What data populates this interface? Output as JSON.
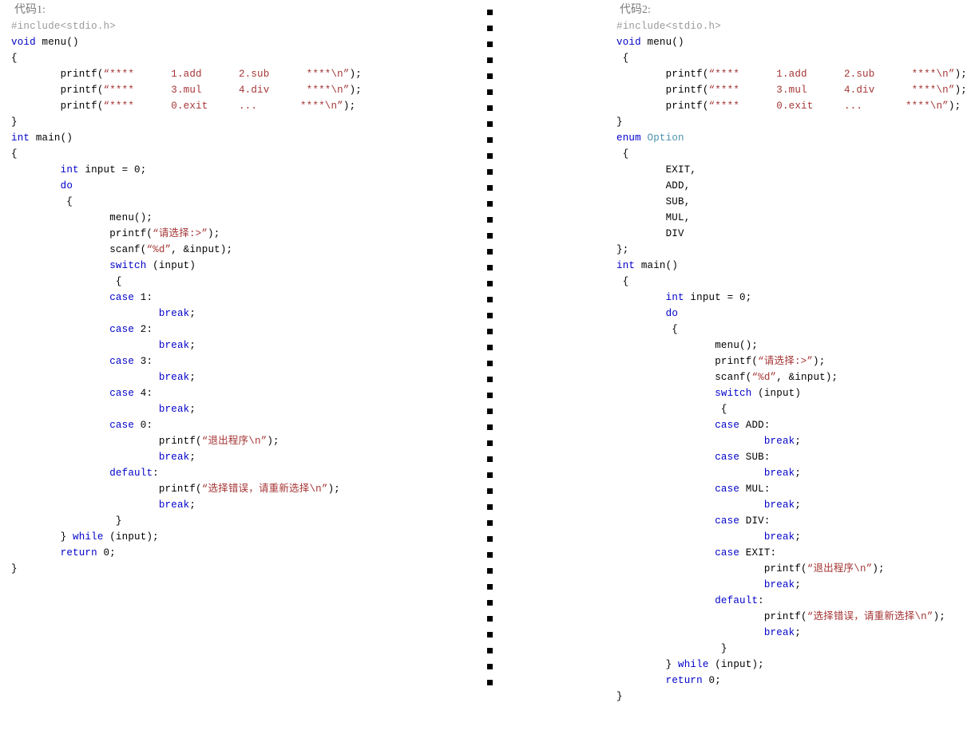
{
  "left": {
    "caption": "代码1:",
    "lines": [
      [
        {
          "t": "#include<stdio.h>",
          "c": "pre"
        }
      ],
      [
        {
          "t": "void ",
          "c": "kw"
        },
        {
          "t": "menu()",
          "c": "pun"
        }
      ],
      [
        {
          "t": "{",
          "c": "pun"
        }
      ],
      [
        {
          "t": "        printf(",
          "c": "pun"
        },
        {
          "t": "“****      1.add      2.sub      ****\\n”",
          "c": "str"
        },
        {
          "t": ");",
          "c": "pun"
        }
      ],
      [
        {
          "t": "        printf(",
          "c": "pun"
        },
        {
          "t": "“****      3.mul      4.div      ****\\n”",
          "c": "str"
        },
        {
          "t": ");",
          "c": "pun"
        }
      ],
      [
        {
          "t": "        printf(",
          "c": "pun"
        },
        {
          "t": "“****      0.exit     ...       ****\\n”",
          "c": "str"
        },
        {
          "t": ");",
          "c": "pun"
        }
      ],
      [
        {
          "t": "}",
          "c": "pun"
        }
      ],
      [
        {
          "t": "int ",
          "c": "kw"
        },
        {
          "t": "main()",
          "c": "pun"
        }
      ],
      [
        {
          "t": "{",
          "c": "pun"
        }
      ],
      [
        {
          "t": "        ",
          "c": "pun"
        },
        {
          "t": "int",
          "c": "kw"
        },
        {
          "t": " input = 0;",
          "c": "pun"
        }
      ],
      [
        {
          "t": "        ",
          "c": "pun"
        },
        {
          "t": "do",
          "c": "kw"
        }
      ],
      [
        {
          "t": "         {",
          "c": "pun"
        }
      ],
      [
        {
          "t": "                menu();",
          "c": "pun"
        }
      ],
      [
        {
          "t": "                printf(",
          "c": "pun"
        },
        {
          "t": "“请选择:>”",
          "c": "str"
        },
        {
          "t": ");",
          "c": "pun"
        }
      ],
      [
        {
          "t": "                scanf(",
          "c": "pun"
        },
        {
          "t": "“%d”",
          "c": "str"
        },
        {
          "t": ", &input);",
          "c": "pun"
        }
      ],
      [
        {
          "t": "                ",
          "c": "pun"
        },
        {
          "t": "switch",
          "c": "kw"
        },
        {
          "t": " (input)",
          "c": "pun"
        }
      ],
      [
        {
          "t": "                 {",
          "c": "pun"
        }
      ],
      [
        {
          "t": "                ",
          "c": "pun"
        },
        {
          "t": "case",
          "c": "kw"
        },
        {
          "t": " 1:",
          "c": "pun"
        }
      ],
      [
        {
          "t": "                        ",
          "c": "pun"
        },
        {
          "t": "break",
          "c": "kw"
        },
        {
          "t": ";",
          "c": "pun"
        }
      ],
      [
        {
          "t": "                ",
          "c": "pun"
        },
        {
          "t": "case",
          "c": "kw"
        },
        {
          "t": " 2:",
          "c": "pun"
        }
      ],
      [
        {
          "t": "                        ",
          "c": "pun"
        },
        {
          "t": "break",
          "c": "kw"
        },
        {
          "t": ";",
          "c": "pun"
        }
      ],
      [
        {
          "t": "                ",
          "c": "pun"
        },
        {
          "t": "case",
          "c": "kw"
        },
        {
          "t": " 3:",
          "c": "pun"
        }
      ],
      [
        {
          "t": "                        ",
          "c": "pun"
        },
        {
          "t": "break",
          "c": "kw"
        },
        {
          "t": ";",
          "c": "pun"
        }
      ],
      [
        {
          "t": "                ",
          "c": "pun"
        },
        {
          "t": "case",
          "c": "kw"
        },
        {
          "t": " 4:",
          "c": "pun"
        }
      ],
      [
        {
          "t": "                        ",
          "c": "pun"
        },
        {
          "t": "break",
          "c": "kw"
        },
        {
          "t": ";",
          "c": "pun"
        }
      ],
      [
        {
          "t": "                ",
          "c": "pun"
        },
        {
          "t": "case",
          "c": "kw"
        },
        {
          "t": " 0:",
          "c": "pun"
        }
      ],
      [
        {
          "t": "                        printf(",
          "c": "pun"
        },
        {
          "t": "“退出程序\\n”",
          "c": "str"
        },
        {
          "t": ");",
          "c": "pun"
        }
      ],
      [
        {
          "t": "                        ",
          "c": "pun"
        },
        {
          "t": "break",
          "c": "kw"
        },
        {
          "t": ";",
          "c": "pun"
        }
      ],
      [
        {
          "t": "                ",
          "c": "pun"
        },
        {
          "t": "default",
          "c": "kw"
        },
        {
          "t": ":",
          "c": "pun"
        }
      ],
      [
        {
          "t": "                        printf(",
          "c": "pun"
        },
        {
          "t": "“选择错误，请重新选择\\n”",
          "c": "str"
        },
        {
          "t": ");",
          "c": "pun"
        }
      ],
      [
        {
          "t": "                        ",
          "c": "pun"
        },
        {
          "t": "break",
          "c": "kw"
        },
        {
          "t": ";",
          "c": "pun"
        }
      ],
      [
        {
          "t": "                 }",
          "c": "pun"
        }
      ],
      [
        {
          "t": "        } ",
          "c": "pun"
        },
        {
          "t": "while",
          "c": "kw"
        },
        {
          "t": " (input);",
          "c": "pun"
        }
      ],
      [
        {
          "t": "        ",
          "c": "pun"
        },
        {
          "t": "return",
          "c": "kw"
        },
        {
          "t": " 0;",
          "c": "pun"
        }
      ],
      [
        {
          "t": "}",
          "c": "pun"
        }
      ]
    ]
  },
  "right": {
    "caption": "代码2:",
    "lines": [
      [
        {
          "t": "#include<stdio.h>",
          "c": "pre"
        }
      ],
      [
        {
          "t": "void ",
          "c": "kw"
        },
        {
          "t": "menu()",
          "c": "pun"
        }
      ],
      [
        {
          "t": " {",
          "c": "pun"
        }
      ],
      [
        {
          "t": "        printf(",
          "c": "pun"
        },
        {
          "t": "“****      1.add      2.sub      ****\\n”",
          "c": "str"
        },
        {
          "t": ");",
          "c": "pun"
        }
      ],
      [
        {
          "t": "        printf(",
          "c": "pun"
        },
        {
          "t": "“****      3.mul      4.div      ****\\n”",
          "c": "str"
        },
        {
          "t": ");",
          "c": "pun"
        }
      ],
      [
        {
          "t": "        printf(",
          "c": "pun"
        },
        {
          "t": "“****      0.exit     ...       ****\\n”",
          "c": "str"
        },
        {
          "t": ");",
          "c": "pun"
        }
      ],
      [
        {
          "t": "}",
          "c": "pun"
        }
      ],
      [
        {
          "t": "enum ",
          "c": "kw"
        },
        {
          "t": "Option",
          "c": "typ"
        }
      ],
      [
        {
          "t": " {",
          "c": "pun"
        }
      ],
      [
        {
          "t": "        EXIT,",
          "c": "pun"
        }
      ],
      [
        {
          "t": "        ADD,",
          "c": "pun"
        }
      ],
      [
        {
          "t": "        SUB,",
          "c": "pun"
        }
      ],
      [
        {
          "t": "        MUL,",
          "c": "pun"
        }
      ],
      [
        {
          "t": "        DIV",
          "c": "pun"
        }
      ],
      [
        {
          "t": "};",
          "c": "pun"
        }
      ],
      [
        {
          "t": "int ",
          "c": "kw"
        },
        {
          "t": "main()",
          "c": "pun"
        }
      ],
      [
        {
          "t": " {",
          "c": "pun"
        }
      ],
      [
        {
          "t": "        ",
          "c": "pun"
        },
        {
          "t": "int",
          "c": "kw"
        },
        {
          "t": " input = 0;",
          "c": "pun"
        }
      ],
      [
        {
          "t": "        ",
          "c": "pun"
        },
        {
          "t": "do",
          "c": "kw"
        }
      ],
      [
        {
          "t": "         {",
          "c": "pun"
        }
      ],
      [
        {
          "t": "                menu();",
          "c": "pun"
        }
      ],
      [
        {
          "t": "                printf(",
          "c": "pun"
        },
        {
          "t": "“请选择:>”",
          "c": "str"
        },
        {
          "t": ");",
          "c": "pun"
        }
      ],
      [
        {
          "t": "                scanf(",
          "c": "pun"
        },
        {
          "t": "“%d”",
          "c": "str"
        },
        {
          "t": ", &input);",
          "c": "pun"
        }
      ],
      [
        {
          "t": "                ",
          "c": "pun"
        },
        {
          "t": "switch",
          "c": "kw"
        },
        {
          "t": " (input)",
          "c": "pun"
        }
      ],
      [
        {
          "t": "                 {",
          "c": "pun"
        }
      ],
      [
        {
          "t": "                ",
          "c": "pun"
        },
        {
          "t": "case",
          "c": "kw"
        },
        {
          "t": " ADD:",
          "c": "pun"
        }
      ],
      [
        {
          "t": "                        ",
          "c": "pun"
        },
        {
          "t": "break",
          "c": "kw"
        },
        {
          "t": ";",
          "c": "pun"
        }
      ],
      [
        {
          "t": "                ",
          "c": "pun"
        },
        {
          "t": "case",
          "c": "kw"
        },
        {
          "t": " SUB:",
          "c": "pun"
        }
      ],
      [
        {
          "t": "                        ",
          "c": "pun"
        },
        {
          "t": "break",
          "c": "kw"
        },
        {
          "t": ";",
          "c": "pun"
        }
      ],
      [
        {
          "t": "                ",
          "c": "pun"
        },
        {
          "t": "case",
          "c": "kw"
        },
        {
          "t": " MUL:",
          "c": "pun"
        }
      ],
      [
        {
          "t": "                        ",
          "c": "pun"
        },
        {
          "t": "break",
          "c": "kw"
        },
        {
          "t": ";",
          "c": "pun"
        }
      ],
      [
        {
          "t": "                ",
          "c": "pun"
        },
        {
          "t": "case",
          "c": "kw"
        },
        {
          "t": " DIV:",
          "c": "pun"
        }
      ],
      [
        {
          "t": "                        ",
          "c": "pun"
        },
        {
          "t": "break",
          "c": "kw"
        },
        {
          "t": ";",
          "c": "pun"
        }
      ],
      [
        {
          "t": "                ",
          "c": "pun"
        },
        {
          "t": "case",
          "c": "kw"
        },
        {
          "t": " EXIT:",
          "c": "pun"
        }
      ],
      [
        {
          "t": "                        printf(",
          "c": "pun"
        },
        {
          "t": "“退出程序\\n”",
          "c": "str"
        },
        {
          "t": ");",
          "c": "pun"
        }
      ],
      [
        {
          "t": "                        ",
          "c": "pun"
        },
        {
          "t": "break",
          "c": "kw"
        },
        {
          "t": ";",
          "c": "pun"
        }
      ],
      [
        {
          "t": "                ",
          "c": "pun"
        },
        {
          "t": "default",
          "c": "kw"
        },
        {
          "t": ":",
          "c": "pun"
        }
      ],
      [
        {
          "t": "                        printf(",
          "c": "pun"
        },
        {
          "t": "“选择错误，请重新选择\\n”",
          "c": "str"
        },
        {
          "t": ");",
          "c": "pun"
        }
      ],
      [
        {
          "t": "                        ",
          "c": "pun"
        },
        {
          "t": "break",
          "c": "kw"
        },
        {
          "t": ";",
          "c": "pun"
        }
      ],
      [
        {
          "t": "                 }",
          "c": "pun"
        }
      ],
      [
        {
          "t": "        } ",
          "c": "pun"
        },
        {
          "t": "while",
          "c": "kw"
        },
        {
          "t": " (input);",
          "c": "pun"
        }
      ],
      [
        {
          "t": "        ",
          "c": "pun"
        },
        {
          "t": "return",
          "c": "kw"
        },
        {
          "t": " 0;",
          "c": "pun"
        }
      ],
      [
        {
          "t": "}",
          "c": "pun"
        }
      ]
    ]
  },
  "divider": {
    "dot_count": 43,
    "color": "#000000"
  },
  "colors": {
    "keyword": "#0000c8",
    "string": "#a53535",
    "preprocessor": "#9a9a9a",
    "type": "#4c92ad",
    "text": "#000000",
    "caption": "#7a7a7a",
    "background": "#ffffff"
  }
}
